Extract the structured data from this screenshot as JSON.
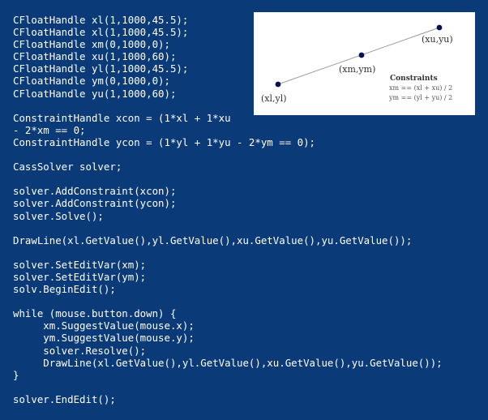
{
  "code_lines": [
    "CFloatHandle xl(1,1000,45.5);",
    "CFloatHandle xl(1,1000,45.5);",
    "CFloatHandle xm(0,1000,0);",
    "CFloatHandle xu(1,1000,60);",
    "CFloatHandle yl(1,1000,45.5);",
    "CFloatHandle ym(0,1000,0);",
    "CFloatHandle yu(1,1000,60);",
    "",
    "ConstraintHandle xcon = (1*xl + 1*xu",
    "- 2*xm == 0;",
    "ConstraintHandle ycon = (1*yl + 1*yu - 2*ym == 0);",
    "",
    "CassSolver solver;",
    "",
    "solver.AddConstraint(xcon);",
    "solver.AddConstraint(ycon);",
    "solver.Solve();",
    "",
    "DrawLine(xl.GetValue(),yl.GetValue(),xu.GetValue(),yu.GetValue());",
    "",
    "solver.SetEditVar(xm);",
    "solver.SetEditVar(ym);",
    "solv.BeginEdit();",
    "",
    "while (mouse.button.down) {",
    "     xm.SuggestValue(mouse.x);",
    "     ym.SuggestValue(mouse.y);",
    "     solver.Resolve();",
    "     DrawLine(xl.GetValue(),yl.GetValue(),xu.GetValue(),yu.GetValue());",
    "}",
    "",
    "solver.EndEdit();"
  ],
  "figure": {
    "label_upper": "(xu,yu)",
    "label_middle": "(xm,ym)",
    "label_lower": "(xl,yl)",
    "constraints_title": "Constraints",
    "constraint_x": "xm == (xl + xu) / 2",
    "constraint_y": "ym == (yl + yu) / 2"
  },
  "colors": {
    "background": "#0b3a78",
    "code_text": "#ffffff",
    "point": "#0a1050",
    "line": "#9a9a9a",
    "figure_text": "#333333"
  }
}
